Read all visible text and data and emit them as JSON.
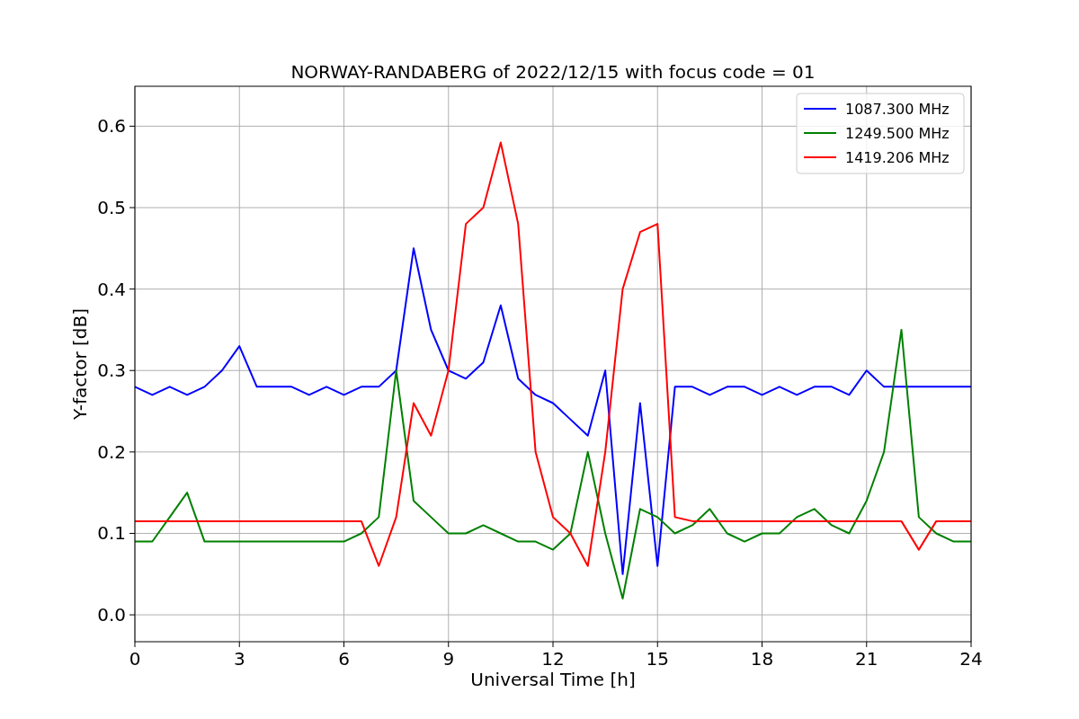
{
  "chart_data": {
    "type": "line",
    "title": "NORWAY-RANDABERG of 2022/12/15 with focus code = 01",
    "xlabel": "Universal Time [h]",
    "ylabel": "Y-factor [dB]",
    "x": [
      0,
      0.5,
      1,
      1.5,
      2,
      2.5,
      3,
      3.5,
      4,
      4.5,
      5,
      5.5,
      6,
      6.5,
      7,
      7.5,
      8,
      8.5,
      9,
      9.5,
      10,
      10.5,
      11,
      11.5,
      12,
      12.5,
      13,
      13.5,
      14,
      14.5,
      15,
      15.5,
      16,
      16.5,
      17,
      17.5,
      18,
      18.5,
      19,
      19.5,
      20,
      20.5,
      21,
      21.5,
      22,
      22.5,
      23,
      23.5,
      24
    ],
    "series": [
      {
        "name": "1087.300 MHz",
        "color": "#0000ff",
        "values": [
          0.28,
          0.27,
          0.28,
          0.27,
          0.28,
          0.3,
          0.33,
          0.28,
          0.28,
          0.28,
          0.27,
          0.28,
          0.27,
          0.28,
          0.28,
          0.3,
          0.45,
          0.35,
          0.3,
          0.29,
          0.31,
          0.38,
          0.29,
          0.27,
          0.26,
          0.24,
          0.22,
          0.3,
          0.05,
          0.26,
          0.06,
          0.28,
          0.28,
          0.27,
          0.28,
          0.28,
          0.27,
          0.28,
          0.27,
          0.28,
          0.28,
          0.27,
          0.3,
          0.28,
          0.28,
          0.28,
          0.28,
          0.28,
          0.28
        ]
      },
      {
        "name": "1249.500 MHz",
        "color": "#008000",
        "values": [
          0.09,
          0.09,
          0.12,
          0.15,
          0.09,
          0.09,
          0.09,
          0.09,
          0.09,
          0.09,
          0.09,
          0.09,
          0.09,
          0.1,
          0.12,
          0.3,
          0.14,
          0.12,
          0.1,
          0.1,
          0.11,
          0.1,
          0.09,
          0.09,
          0.08,
          0.1,
          0.2,
          0.1,
          0.02,
          0.13,
          0.12,
          0.1,
          0.11,
          0.13,
          0.1,
          0.09,
          0.1,
          0.1,
          0.12,
          0.13,
          0.11,
          0.1,
          0.14,
          0.2,
          0.35,
          0.12,
          0.1,
          0.09,
          0.09
        ]
      },
      {
        "name": "1419.206 MHz",
        "color": "#ff0000",
        "values": [
          0.115,
          0.115,
          0.115,
          0.115,
          0.115,
          0.115,
          0.115,
          0.115,
          0.115,
          0.115,
          0.115,
          0.115,
          0.115,
          0.115,
          0.06,
          0.12,
          0.26,
          0.22,
          0.3,
          0.48,
          0.5,
          0.58,
          0.48,
          0.2,
          0.12,
          0.1,
          0.06,
          0.2,
          0.4,
          0.47,
          0.48,
          0.12,
          0.115,
          0.115,
          0.115,
          0.115,
          0.115,
          0.115,
          0.115,
          0.115,
          0.115,
          0.115,
          0.115,
          0.115,
          0.115,
          0.08,
          0.115,
          0.115,
          0.115
        ]
      }
    ],
    "grid": true,
    "legend": true,
    "xlim": [
      0,
      24
    ],
    "ylim": [
      -0.033,
      0.649
    ],
    "xticks": [
      0,
      3,
      6,
      9,
      12,
      15,
      18,
      21,
      24
    ],
    "yticks": [
      {
        "value": 0,
        "label": "0.0"
      },
      {
        "value": 0.1,
        "label": "0.1"
      },
      {
        "value": 0.2,
        "label": "0.2"
      },
      {
        "value": 0.3,
        "label": "0.3"
      },
      {
        "value": 0.4,
        "label": "0.4"
      },
      {
        "value": 0.5,
        "label": "0.5"
      },
      {
        "value": 0.6,
        "label": "0.6"
      }
    ]
  }
}
